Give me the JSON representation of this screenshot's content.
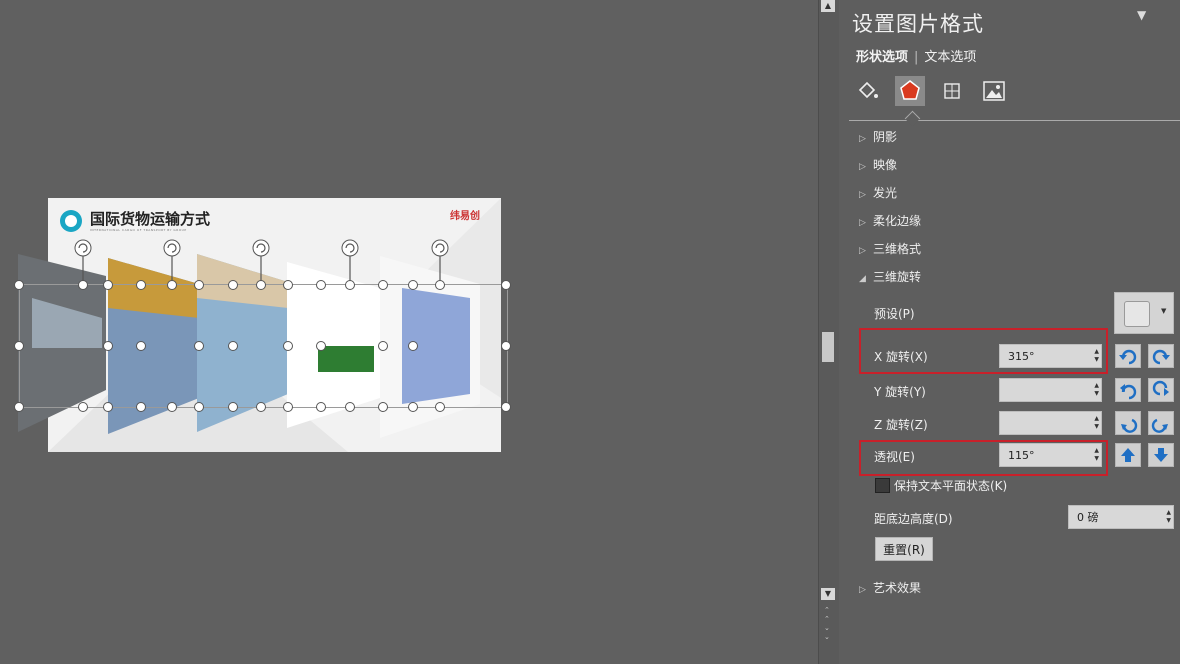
{
  "slide": {
    "title": "国际货物运输方式",
    "subtitle": "INTERNATIONAL CARGO OF TRANSPORT BY GROUP",
    "logo_text": "纬易创"
  },
  "panel": {
    "title": "设置图片格式",
    "tabs": [
      "形状选项",
      "文本选项"
    ],
    "active_tab": 0,
    "icons": [
      "fill-line-icon",
      "effects-pentagon-icon",
      "size-properties-icon",
      "picture-icon"
    ],
    "active_icon": 1,
    "sections": [
      {
        "label": "阴影",
        "expanded": false
      },
      {
        "label": "映像",
        "expanded": false
      },
      {
        "label": "发光",
        "expanded": false
      },
      {
        "label": "柔化边缘",
        "expanded": false
      },
      {
        "label": "三维格式",
        "expanded": false
      },
      {
        "label": "三维旋转",
        "expanded": true
      }
    ],
    "rotation": {
      "preset_label": "预设(P)",
      "x_label": "X 旋转(X)",
      "x_value": "315°",
      "y_label": "Y 旋转(Y)",
      "y_value": "",
      "z_label": "Z 旋转(Z)",
      "z_value": "",
      "perspective_label": "透视(E)",
      "perspective_value": "115°",
      "keep_text_flat_label": "保持文本平面状态(K)",
      "keep_text_flat": false,
      "distance_label": "距底边高度(D)",
      "distance_value": "0 磅",
      "reset_label": "重置(R)"
    },
    "art_section": "艺术效果"
  },
  "colors": {
    "highlight": "#c8202a",
    "accent_teal": "#1aa6c4",
    "selected_icon": "#d93a1f"
  }
}
